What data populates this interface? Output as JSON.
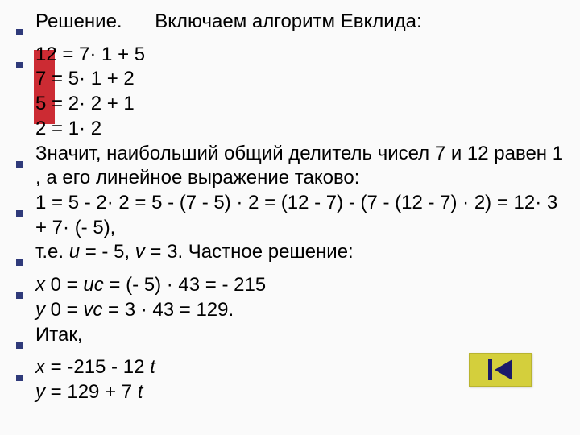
{
  "bullets": [
    {
      "lead": "Решение.",
      "tail": "Включаем алгоритм Евклида:",
      "lines": []
    },
    {
      "lines": [
        "12 = 7· 1 + 5",
        "7 = 5· 1 + 2",
        "5 = 2· 2 + 1",
        "2 = 1· 2"
      ]
    },
    {
      "lines": [
        "Значит, наибольший общий делитель чисел 7 и 12 равен 1 , а его линейное выражение таково:"
      ]
    },
    {
      "lines": [
        "1 = 5 - 2· 2 = 5 - (7 - 5) · 2 = (12 - 7) - (7 - (12 - 7) · 2) = 12· 3 + 7· (- 5),"
      ]
    },
    {
      "html": "т.е. <span class='italic'>u</span> = - 5, <span class='italic'>v</span> = 3. Частное решение:"
    },
    {
      "html": "<span class='italic'>x</span> 0 = <span class='italic'>uc</span> = (- 5) · 43 = - 215<br><span class='italic'>y</span> 0 = <span class='italic'>vc</span> = 3 · 43 = 129."
    },
    {
      "lines": [
        "Итак,"
      ]
    },
    {
      "html": "<span class='italic'>x</span> = -215 - 12&nbsp;<span class='italic'>t</span><br><span class='italic'>y</span> = 129 + 7&nbsp;<span class='italic'>t</span>"
    }
  ],
  "nav": {
    "icon": "skip-back-icon"
  }
}
